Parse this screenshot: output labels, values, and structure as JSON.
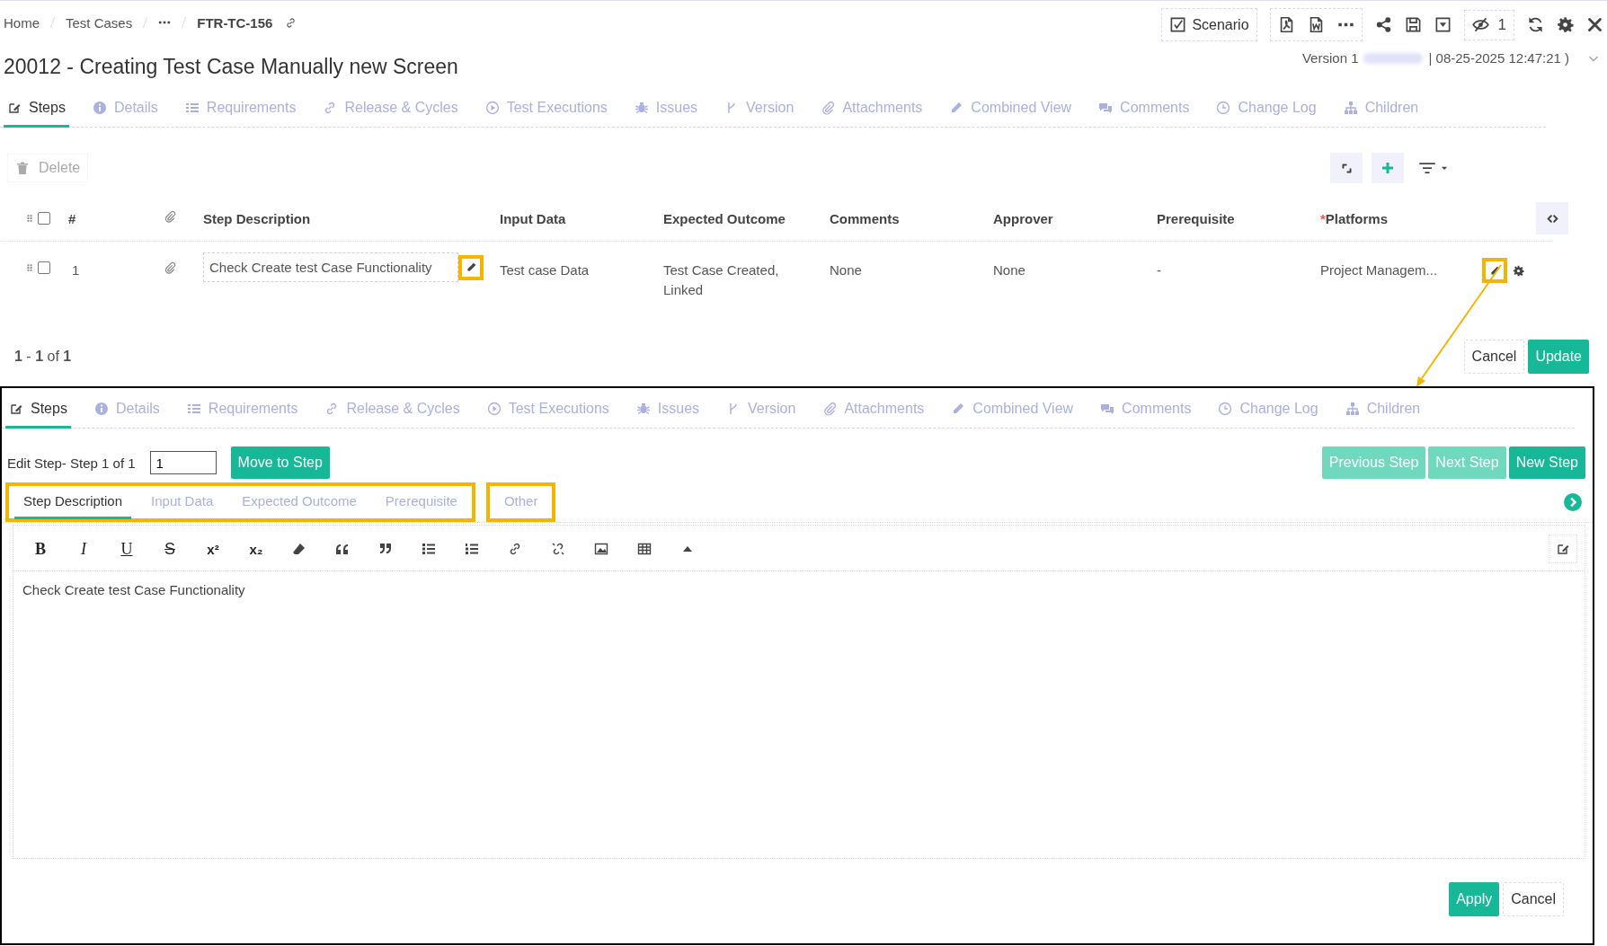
{
  "breadcrumb": {
    "items": [
      {
        "label": "Home"
      },
      {
        "label": "Test Cases"
      }
    ],
    "current": "FTR-TC-156"
  },
  "title": "20012 - Creating Test Case Manually new Screen",
  "header_actions": {
    "scenario_button": "Scenario",
    "watch_count": "1"
  },
  "version": {
    "label": "Version 1",
    "timestamp": "| 08-25-2025 12:47:21 )"
  },
  "tabs": [
    {
      "label": "Steps",
      "selected": true
    },
    {
      "label": "Details",
      "selected": false
    },
    {
      "label": "Requirements",
      "selected": false
    },
    {
      "label": "Release & Cycles",
      "selected": false
    },
    {
      "label": "Test Executions",
      "selected": false
    },
    {
      "label": "Issues",
      "selected": false
    },
    {
      "label": "Version",
      "selected": false
    },
    {
      "label": "Attachments",
      "selected": false
    },
    {
      "label": "Combined View",
      "selected": false
    },
    {
      "label": "Comments",
      "selected": false
    },
    {
      "label": "Change Log",
      "selected": false
    },
    {
      "label": "Children",
      "selected": false
    }
  ],
  "delete_button": {
    "label": "Delete",
    "disabled": true
  },
  "table": {
    "all_checked": false,
    "columns": [
      {
        "label": "#"
      },
      {
        "label": "Step Description"
      },
      {
        "label": "Input Data"
      },
      {
        "label": "Expected Outcome"
      },
      {
        "label": "Comments"
      },
      {
        "label": "Approver"
      },
      {
        "label": "Prerequisite"
      },
      {
        "label": "Platforms",
        "required_mark": "*"
      }
    ],
    "rows": [
      {
        "checked": false,
        "number": "1",
        "step_description": "Check Create test Case Functionality",
        "input_data": "Test case Data",
        "expected_outcome": "Test Case Created, Linked",
        "comments": "None",
        "approver": "None",
        "prerequisite": "-",
        "platforms": "Project Managem..."
      }
    ]
  },
  "pagination": "**1** - **1** of **1**",
  "form_buttons": [
    {
      "label": "Cancel",
      "kind": "secondary"
    },
    {
      "label": "Update",
      "kind": "primary"
    }
  ],
  "edit_panel": {
    "tabs": [
      {
        "label": "Steps",
        "selected": true
      },
      {
        "label": "Details",
        "selected": false
      },
      {
        "label": "Requirements",
        "selected": false
      },
      {
        "label": "Release & Cycles",
        "selected": false
      },
      {
        "label": "Test Executions",
        "selected": false
      },
      {
        "label": "Issues",
        "selected": false
      },
      {
        "label": "Version",
        "selected": false
      },
      {
        "label": "Attachments",
        "selected": false
      },
      {
        "label": "Combined View",
        "selected": false
      },
      {
        "label": "Comments",
        "selected": false
      },
      {
        "label": "Change Log",
        "selected": false
      },
      {
        "label": "Children",
        "selected": false
      }
    ],
    "step_label": "Edit Step- Step 1 of 1",
    "step_input": "1",
    "move_button": "Move to Step",
    "nav_buttons": [
      {
        "label": "Previous Step",
        "disabled": true
      },
      {
        "label": "Next Step",
        "disabled": true
      },
      {
        "label": "New Step",
        "disabled": false
      }
    ],
    "field_tab_groups": [
      {
        "highlighted": true,
        "tabs": [
          {
            "label": "Step Description",
            "selected": true
          },
          {
            "label": "Input Data",
            "selected": false
          },
          {
            "label": "Expected Outcome",
            "selected": false
          },
          {
            "label": "Prerequisite",
            "selected": false
          }
        ]
      },
      {
        "highlighted": true,
        "tabs": [
          {
            "label": "Other",
            "selected": false
          }
        ]
      }
    ],
    "editor_toolbar": [
      {
        "kind": "bold",
        "label": "B"
      },
      {
        "kind": "italic",
        "label": "I"
      },
      {
        "kind": "underline",
        "label": "U"
      },
      {
        "kind": "strike",
        "label": "S"
      },
      {
        "kind": "superscript",
        "label": "x²"
      },
      {
        "kind": "subscript",
        "label": "x₂"
      },
      {
        "kind": "eraser"
      },
      {
        "kind": "quote-open"
      },
      {
        "kind": "quote-close"
      },
      {
        "kind": "bullet-list"
      },
      {
        "kind": "numbered-list"
      },
      {
        "kind": "link"
      },
      {
        "kind": "unlink"
      },
      {
        "kind": "image"
      },
      {
        "kind": "table"
      },
      {
        "kind": "collapse"
      }
    ],
    "editor_text": "Check Create test Case Functionality",
    "footer_buttons": [
      {
        "label": "Apply",
        "kind": "primary"
      },
      {
        "label": "Cancel",
        "kind": "secondary"
      }
    ]
  }
}
